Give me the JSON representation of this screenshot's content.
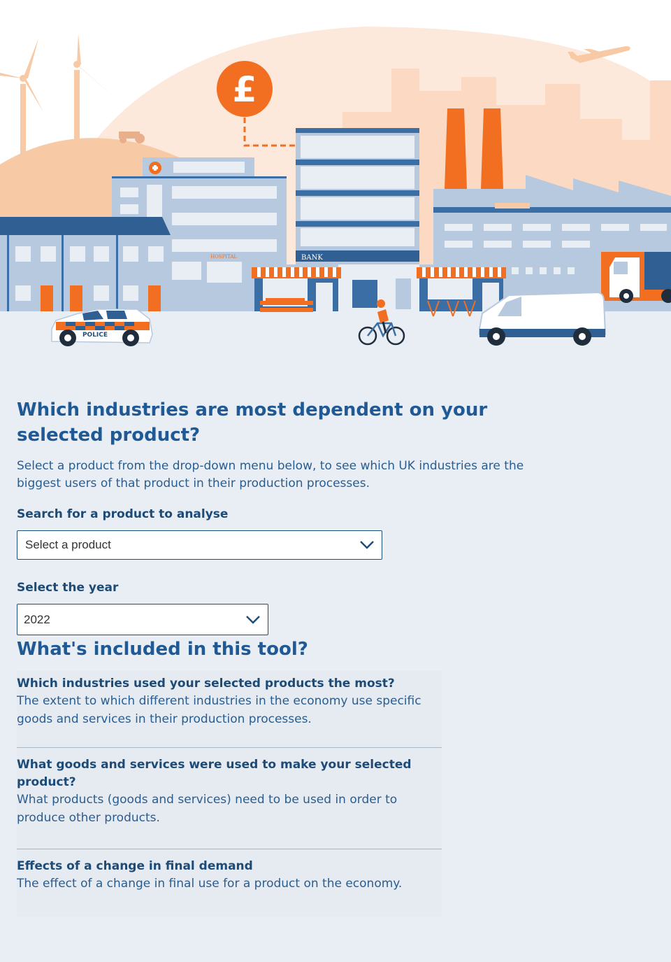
{
  "hero": {
    "currency_symbol": "£",
    "bank_sign": "BANK",
    "hospital_sign": "HOSPITAL",
    "police_car_label": "POLICE",
    "colors": {
      "orange": "#f26f21",
      "light_orange": "#f7c9a4",
      "peach_bg": "#fde9dc",
      "navy": "#1f4e79",
      "steel_blue": "#3a6ea5",
      "light_blue": "#b7c9de",
      "page_bg": "#e9eef5"
    }
  },
  "main": {
    "title": "Which industries are most dependent on your selected product?",
    "intro": "Select a product from the drop-down menu below, to see which UK industries are the biggest users of that product in their production processes.",
    "product_search": {
      "label": "Search for a product to analyse",
      "selected_value": "Select a product"
    },
    "year_select": {
      "label": "Select the year",
      "selected_value": "2022"
    }
  },
  "tool_info": {
    "title": "What's included in this tool?",
    "items": [
      {
        "title": "Which industries used your selected products the most?",
        "description": "The extent to which different industries in the economy use specific goods and services in their production processes."
      },
      {
        "title": "What goods and services were used to make your selected product?",
        "description": "What products (goods and services) need to be used in order to produce other products."
      },
      {
        "title": "Effects of a change in final demand",
        "description": "The effect of a change in final use for a product on the economy."
      }
    ]
  }
}
